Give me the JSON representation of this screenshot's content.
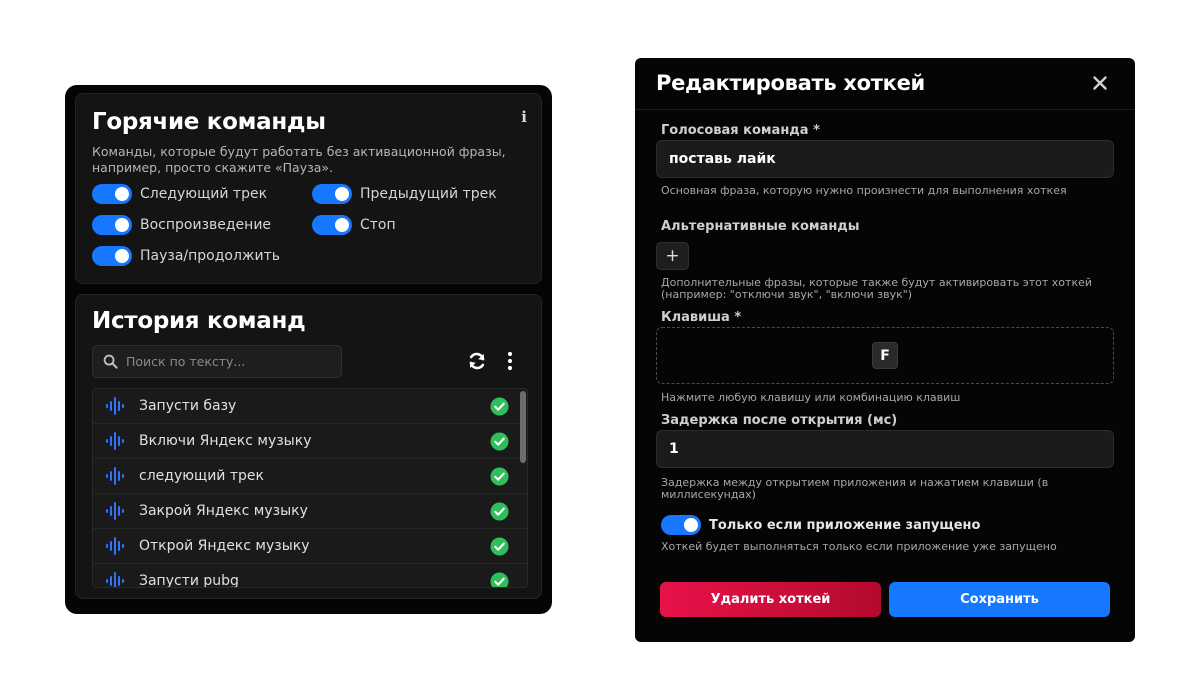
{
  "hotkeys_panel": {
    "title": "Горячие команды",
    "info_label": "i",
    "description": "Команды, которые будут работать без активационной фразы, например, просто скажите «Пауза».",
    "toggles": [
      {
        "label": "Следующий трек",
        "on": true
      },
      {
        "label": "Предыдущий трек",
        "on": true
      },
      {
        "label": "Воспроизведение",
        "on": true
      },
      {
        "label": "Стоп",
        "on": true
      },
      {
        "label": "Пауза/продолжить",
        "on": true
      }
    ]
  },
  "history_panel": {
    "title": "История команд",
    "search_placeholder": "Поиск по тексту...",
    "items": [
      {
        "text": "Запусти базу",
        "status": "success"
      },
      {
        "text": "Включи Яндекс музыку",
        "status": "success"
      },
      {
        "text": "следующий трек",
        "status": "success"
      },
      {
        "text": "Закрой Яндекс музыку",
        "status": "success"
      },
      {
        "text": "Открой Яндекс музыку",
        "status": "success"
      },
      {
        "text": "Запусти pubg",
        "status": "success"
      }
    ]
  },
  "edit_modal": {
    "title": "Редактировать хоткей",
    "voice_command": {
      "label": "Голосовая команда *",
      "value": "поставь лайк",
      "hint": "Основная фраза, которую нужно произнести для выполнения хоткея"
    },
    "alt_commands": {
      "label": "Альтернативные команды",
      "add_label": "+",
      "hint": "Дополнительные фразы, которые также будут активировать этот хоткей (например: \"отключи звук\", \"включи звук\")"
    },
    "key": {
      "label": "Клавиша *",
      "value": "F",
      "hint": "Нажмите любую клавишу или комбинацию клавиш"
    },
    "delay": {
      "label": "Задержка после открытия (мс)",
      "value": "1",
      "hint": "Задержка между открытием приложения и нажатием клавиши (в миллисекундах)"
    },
    "only_if_running": {
      "label": "Только если приложение запущено",
      "on": true,
      "hint": "Хоткей будет выполняться только если приложение уже запущено"
    },
    "delete_label": "Удалить хоткей",
    "save_label": "Сохранить"
  },
  "colors": {
    "accent": "#1677ff",
    "success": "#2fbf5a",
    "danger": "#e8124a",
    "card_bg": "#050505"
  }
}
